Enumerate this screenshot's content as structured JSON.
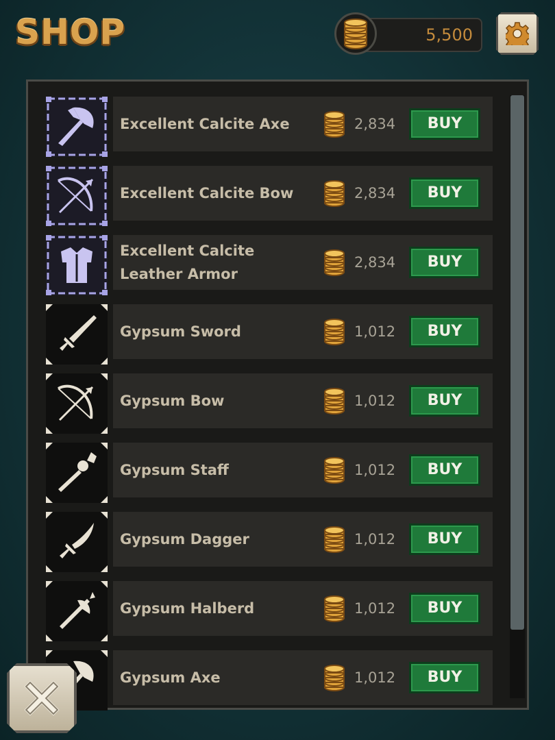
{
  "header": {
    "title": "SHOP",
    "balance": "5,500",
    "coin_icon": "coin-stack-icon",
    "settings_icon": "gear-icon"
  },
  "colors": {
    "title_gold": "#d9a24e",
    "buy_green": "#1f7a3a",
    "rare_frame": "#a8a4e6",
    "common_frame": "#e8e2d4",
    "price_text": "#a8a396"
  },
  "shop": {
    "buy_label": "BUY",
    "items": [
      {
        "name": "Excellent Calcite Axe",
        "price": "2,834",
        "icon": "axe-icon",
        "tier": "rare"
      },
      {
        "name": "Excellent Calcite Bow",
        "price": "2,834",
        "icon": "bow-icon",
        "tier": "rare"
      },
      {
        "name": "Excellent Calcite Leather Armor",
        "price": "2,834",
        "icon": "armor-icon",
        "tier": "rare"
      },
      {
        "name": "Gypsum Sword",
        "price": "1,012",
        "icon": "sword-icon",
        "tier": "common"
      },
      {
        "name": "Gypsum Bow",
        "price": "1,012",
        "icon": "bow-icon",
        "tier": "common"
      },
      {
        "name": "Gypsum Staff",
        "price": "1,012",
        "icon": "staff-icon",
        "tier": "common"
      },
      {
        "name": "Gypsum Dagger",
        "price": "1,012",
        "icon": "dagger-icon",
        "tier": "common"
      },
      {
        "name": "Gypsum Halberd",
        "price": "1,012",
        "icon": "halberd-icon",
        "tier": "common"
      },
      {
        "name": "Gypsum Axe",
        "price": "1,012",
        "icon": "axe-icon",
        "tier": "common"
      }
    ]
  },
  "footer": {
    "close_icon": "close-icon"
  }
}
